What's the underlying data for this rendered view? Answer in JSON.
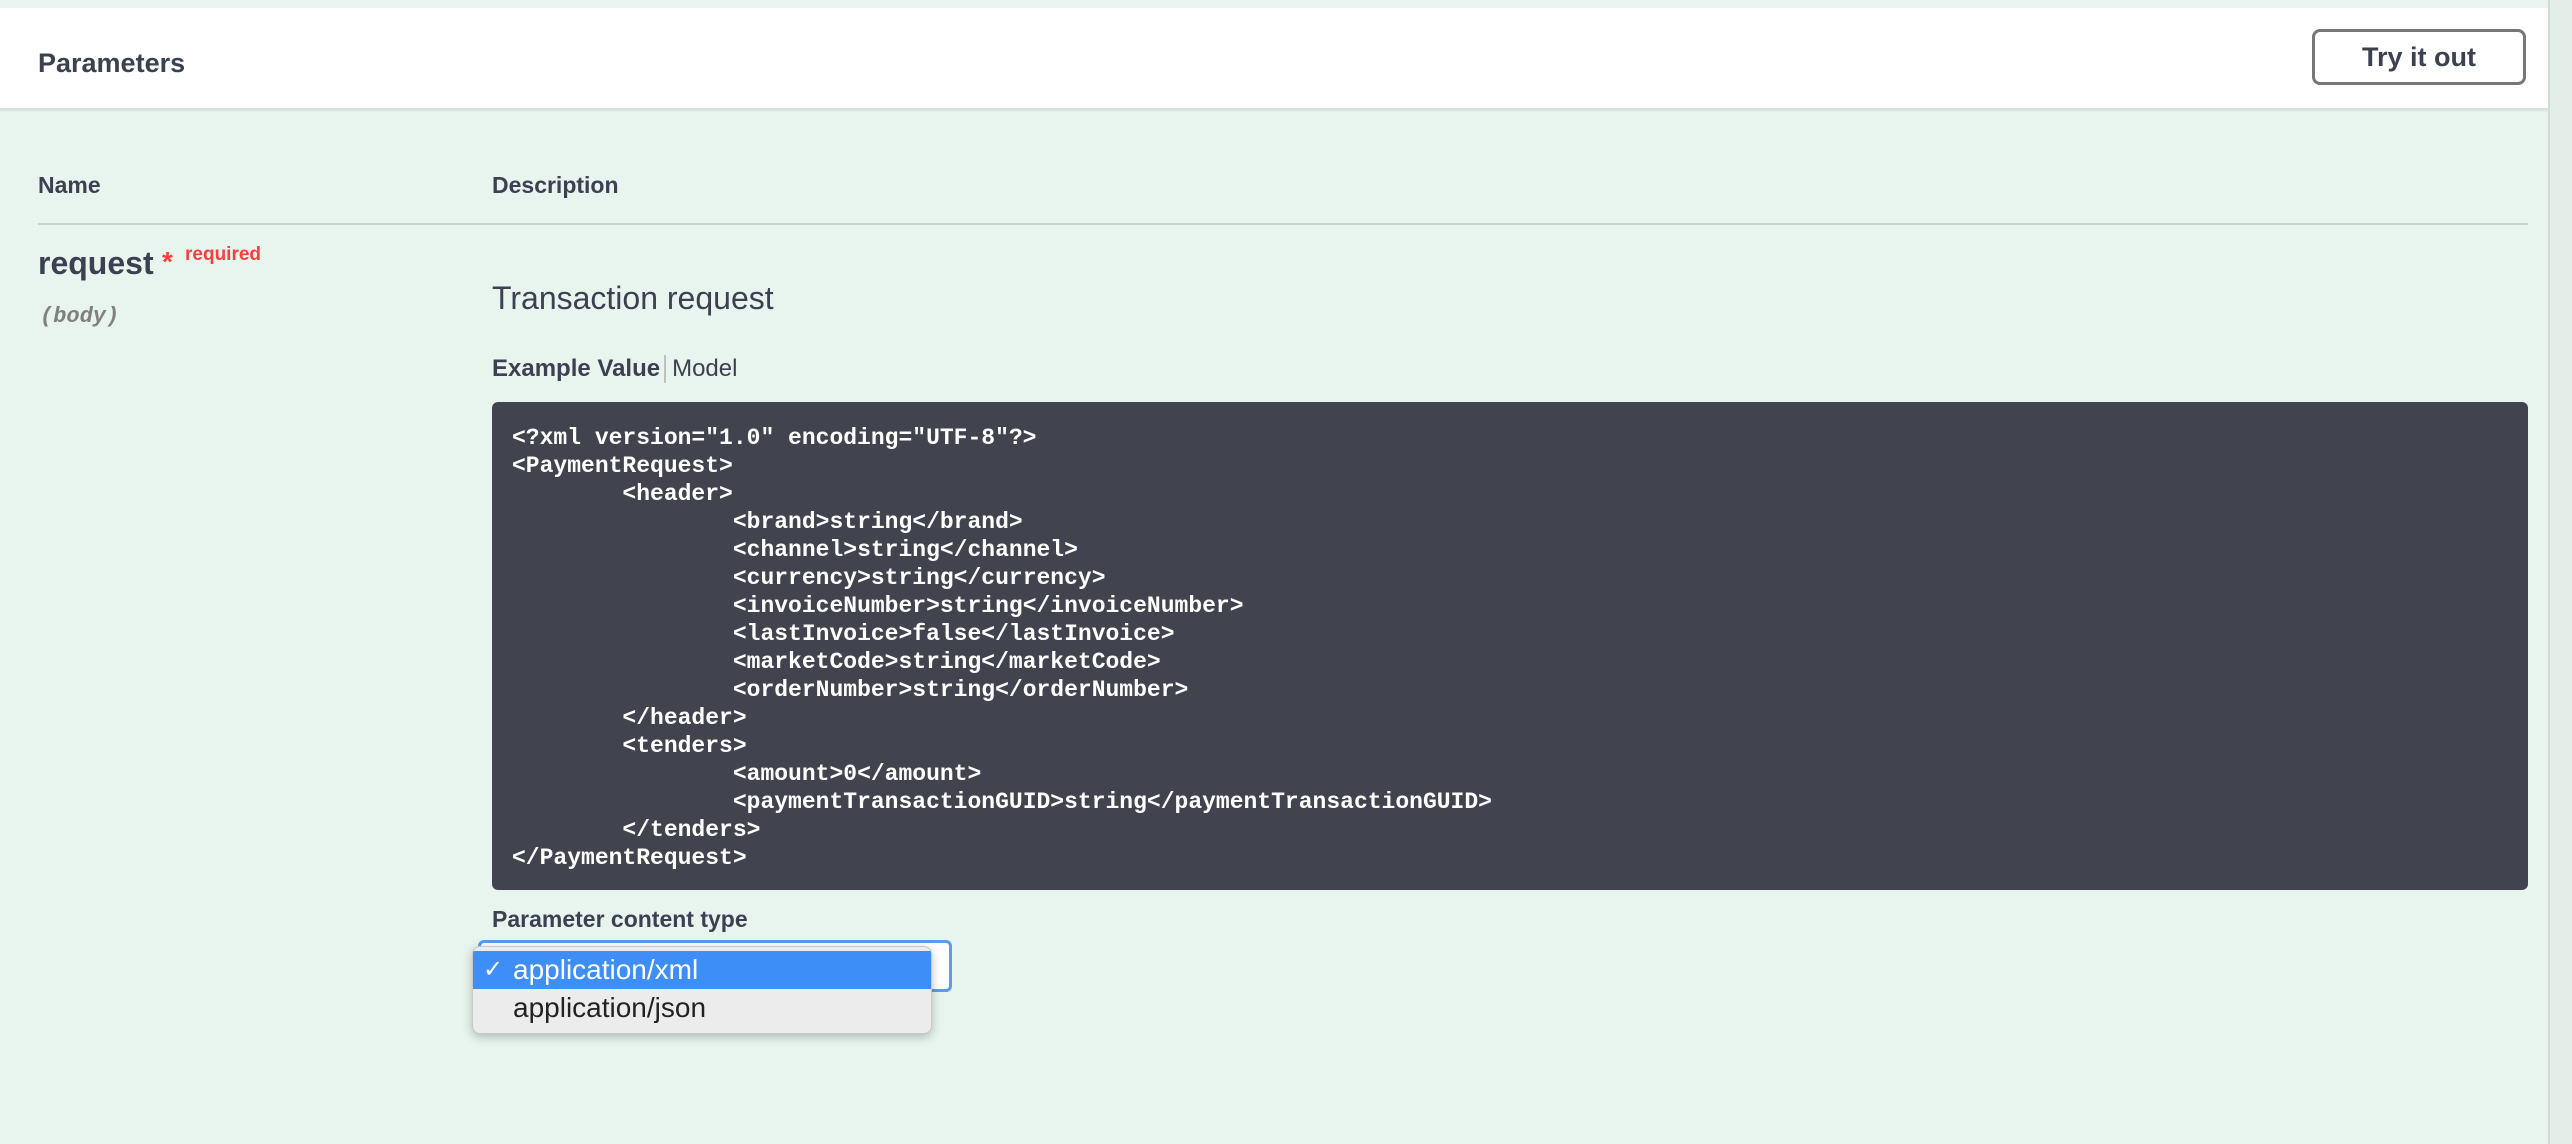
{
  "header": {
    "title": "Parameters",
    "try_it_out_label": "Try it out"
  },
  "table": {
    "col_name": "Name",
    "col_description": "Description"
  },
  "parameter": {
    "name": "request",
    "required_star": "*",
    "required_label": "required",
    "location": "(body)",
    "description": "Transaction request"
  },
  "tabs": {
    "example_value": "Example Value",
    "model": "Model"
  },
  "example_xml": "<?xml version=\"1.0\" encoding=\"UTF-8\"?>\n<PaymentRequest>\n\t<header>\n\t\t<brand>string</brand>\n\t\t<channel>string</channel>\n\t\t<currency>string</currency>\n\t\t<invoiceNumber>string</invoiceNumber>\n\t\t<lastInvoice>false</lastInvoice>\n\t\t<marketCode>string</marketCode>\n\t\t<orderNumber>string</orderNumber>\n\t</header>\n\t<tenders>\n\t\t<amount>0</amount>\n\t\t<paymentTransactionGUID>string</paymentTransactionGUID>\n\t</tenders>\n</PaymentRequest>",
  "content_type": {
    "label": "Parameter content type",
    "options": [
      {
        "label": "application/xml",
        "selected": true
      },
      {
        "label": "application/json",
        "selected": false
      }
    ]
  },
  "colors": {
    "background": "#e8f5ee",
    "code_background": "#41444e",
    "required": "#f93e3e",
    "selected_option": "#3d8ef7"
  },
  "icons": {
    "selected_mark": "check-icon"
  }
}
